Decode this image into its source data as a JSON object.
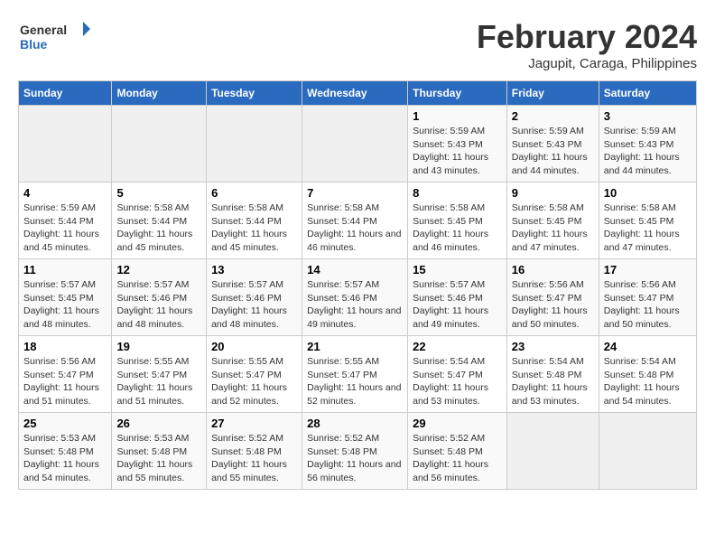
{
  "header": {
    "logo_line1": "General",
    "logo_line2": "Blue",
    "title": "February 2024",
    "subtitle": "Jagupit, Caraga, Philippines"
  },
  "weekdays": [
    "Sunday",
    "Monday",
    "Tuesday",
    "Wednesday",
    "Thursday",
    "Friday",
    "Saturday"
  ],
  "weeks": [
    [
      {
        "day": "",
        "sunrise": "",
        "sunset": "",
        "daylight": ""
      },
      {
        "day": "",
        "sunrise": "",
        "sunset": "",
        "daylight": ""
      },
      {
        "day": "",
        "sunrise": "",
        "sunset": "",
        "daylight": ""
      },
      {
        "day": "",
        "sunrise": "",
        "sunset": "",
        "daylight": ""
      },
      {
        "day": "1",
        "sunrise": "Sunrise: 5:59 AM",
        "sunset": "Sunset: 5:43 PM",
        "daylight": "Daylight: 11 hours and 43 minutes."
      },
      {
        "day": "2",
        "sunrise": "Sunrise: 5:59 AM",
        "sunset": "Sunset: 5:43 PM",
        "daylight": "Daylight: 11 hours and 44 minutes."
      },
      {
        "day": "3",
        "sunrise": "Sunrise: 5:59 AM",
        "sunset": "Sunset: 5:43 PM",
        "daylight": "Daylight: 11 hours and 44 minutes."
      }
    ],
    [
      {
        "day": "4",
        "sunrise": "Sunrise: 5:59 AM",
        "sunset": "Sunset: 5:44 PM",
        "daylight": "Daylight: 11 hours and 45 minutes."
      },
      {
        "day": "5",
        "sunrise": "Sunrise: 5:58 AM",
        "sunset": "Sunset: 5:44 PM",
        "daylight": "Daylight: 11 hours and 45 minutes."
      },
      {
        "day": "6",
        "sunrise": "Sunrise: 5:58 AM",
        "sunset": "Sunset: 5:44 PM",
        "daylight": "Daylight: 11 hours and 45 minutes."
      },
      {
        "day": "7",
        "sunrise": "Sunrise: 5:58 AM",
        "sunset": "Sunset: 5:44 PM",
        "daylight": "Daylight: 11 hours and 46 minutes."
      },
      {
        "day": "8",
        "sunrise": "Sunrise: 5:58 AM",
        "sunset": "Sunset: 5:45 PM",
        "daylight": "Daylight: 11 hours and 46 minutes."
      },
      {
        "day": "9",
        "sunrise": "Sunrise: 5:58 AM",
        "sunset": "Sunset: 5:45 PM",
        "daylight": "Daylight: 11 hours and 47 minutes."
      },
      {
        "day": "10",
        "sunrise": "Sunrise: 5:58 AM",
        "sunset": "Sunset: 5:45 PM",
        "daylight": "Daylight: 11 hours and 47 minutes."
      }
    ],
    [
      {
        "day": "11",
        "sunrise": "Sunrise: 5:57 AM",
        "sunset": "Sunset: 5:45 PM",
        "daylight": "Daylight: 11 hours and 48 minutes."
      },
      {
        "day": "12",
        "sunrise": "Sunrise: 5:57 AM",
        "sunset": "Sunset: 5:46 PM",
        "daylight": "Daylight: 11 hours and 48 minutes."
      },
      {
        "day": "13",
        "sunrise": "Sunrise: 5:57 AM",
        "sunset": "Sunset: 5:46 PM",
        "daylight": "Daylight: 11 hours and 48 minutes."
      },
      {
        "day": "14",
        "sunrise": "Sunrise: 5:57 AM",
        "sunset": "Sunset: 5:46 PM",
        "daylight": "Daylight: 11 hours and 49 minutes."
      },
      {
        "day": "15",
        "sunrise": "Sunrise: 5:57 AM",
        "sunset": "Sunset: 5:46 PM",
        "daylight": "Daylight: 11 hours and 49 minutes."
      },
      {
        "day": "16",
        "sunrise": "Sunrise: 5:56 AM",
        "sunset": "Sunset: 5:47 PM",
        "daylight": "Daylight: 11 hours and 50 minutes."
      },
      {
        "day": "17",
        "sunrise": "Sunrise: 5:56 AM",
        "sunset": "Sunset: 5:47 PM",
        "daylight": "Daylight: 11 hours and 50 minutes."
      }
    ],
    [
      {
        "day": "18",
        "sunrise": "Sunrise: 5:56 AM",
        "sunset": "Sunset: 5:47 PM",
        "daylight": "Daylight: 11 hours and 51 minutes."
      },
      {
        "day": "19",
        "sunrise": "Sunrise: 5:55 AM",
        "sunset": "Sunset: 5:47 PM",
        "daylight": "Daylight: 11 hours and 51 minutes."
      },
      {
        "day": "20",
        "sunrise": "Sunrise: 5:55 AM",
        "sunset": "Sunset: 5:47 PM",
        "daylight": "Daylight: 11 hours and 52 minutes."
      },
      {
        "day": "21",
        "sunrise": "Sunrise: 5:55 AM",
        "sunset": "Sunset: 5:47 PM",
        "daylight": "Daylight: 11 hours and 52 minutes."
      },
      {
        "day": "22",
        "sunrise": "Sunrise: 5:54 AM",
        "sunset": "Sunset: 5:47 PM",
        "daylight": "Daylight: 11 hours and 53 minutes."
      },
      {
        "day": "23",
        "sunrise": "Sunrise: 5:54 AM",
        "sunset": "Sunset: 5:48 PM",
        "daylight": "Daylight: 11 hours and 53 minutes."
      },
      {
        "day": "24",
        "sunrise": "Sunrise: 5:54 AM",
        "sunset": "Sunset: 5:48 PM",
        "daylight": "Daylight: 11 hours and 54 minutes."
      }
    ],
    [
      {
        "day": "25",
        "sunrise": "Sunrise: 5:53 AM",
        "sunset": "Sunset: 5:48 PM",
        "daylight": "Daylight: 11 hours and 54 minutes."
      },
      {
        "day": "26",
        "sunrise": "Sunrise: 5:53 AM",
        "sunset": "Sunset: 5:48 PM",
        "daylight": "Daylight: 11 hours and 55 minutes."
      },
      {
        "day": "27",
        "sunrise": "Sunrise: 5:52 AM",
        "sunset": "Sunset: 5:48 PM",
        "daylight": "Daylight: 11 hours and 55 minutes."
      },
      {
        "day": "28",
        "sunrise": "Sunrise: 5:52 AM",
        "sunset": "Sunset: 5:48 PM",
        "daylight": "Daylight: 11 hours and 56 minutes."
      },
      {
        "day": "29",
        "sunrise": "Sunrise: 5:52 AM",
        "sunset": "Sunset: 5:48 PM",
        "daylight": "Daylight: 11 hours and 56 minutes."
      },
      {
        "day": "",
        "sunrise": "",
        "sunset": "",
        "daylight": ""
      },
      {
        "day": "",
        "sunrise": "",
        "sunset": "",
        "daylight": ""
      }
    ]
  ]
}
